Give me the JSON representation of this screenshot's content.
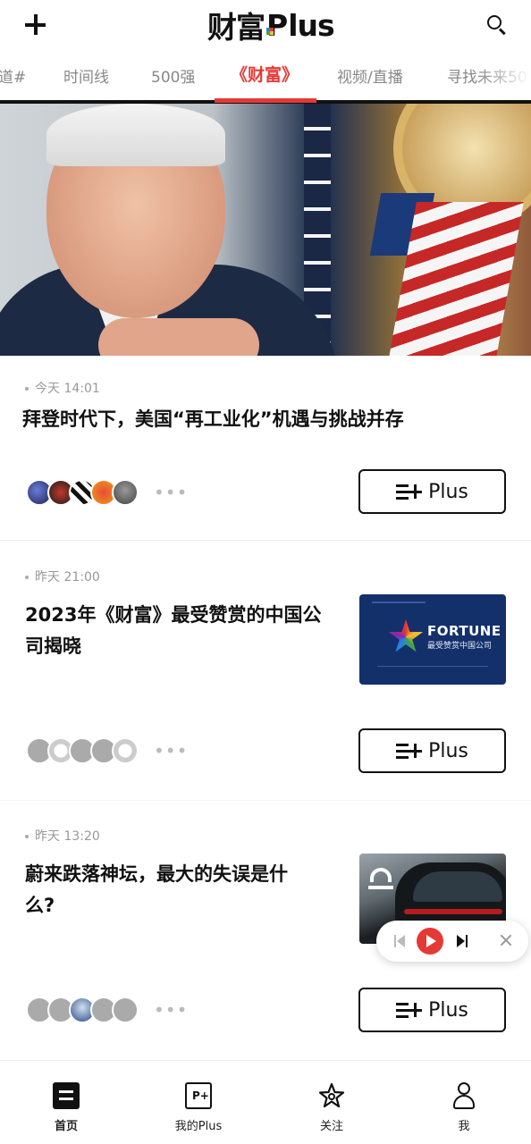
{
  "header": {
    "logo_cn": "财富",
    "logo_p": "P",
    "logo_lus": "lus"
  },
  "tabs": [
    "道#",
    "时间线",
    "500强",
    "《财富》",
    "视频/直播",
    "寻找未来50"
  ],
  "active_tab": "《财富》",
  "articles": [
    {
      "time": "今天 14:01",
      "title": "拜登时代下，美国“再工业化”机遇与挑战并存",
      "plus_label": "Plus"
    },
    {
      "time": "昨天 21:00",
      "title_line1": "2023年《财富》最受赞赏的中国公",
      "title_line2": "司揭晓",
      "plus_label": "Plus",
      "thumb_brand": "FORTUNE",
      "thumb_sub": "最受赞赏中国公司"
    },
    {
      "time": "昨天 13:20",
      "title_line1": "蔚来跌落神坛，最大的失误是什",
      "title_line2": "么?",
      "plus_label": "Plus"
    }
  ],
  "bottom_nav": [
    {
      "label": "首页",
      "icon": "home-icon"
    },
    {
      "label": "我的Plus",
      "icon": "my-plus-icon"
    },
    {
      "label": "关注",
      "icon": "star-icon"
    },
    {
      "label": "我",
      "icon": "profile-icon"
    }
  ],
  "colors": {
    "accent": "#e53935",
    "text": "#111111",
    "muted": "#999999"
  }
}
